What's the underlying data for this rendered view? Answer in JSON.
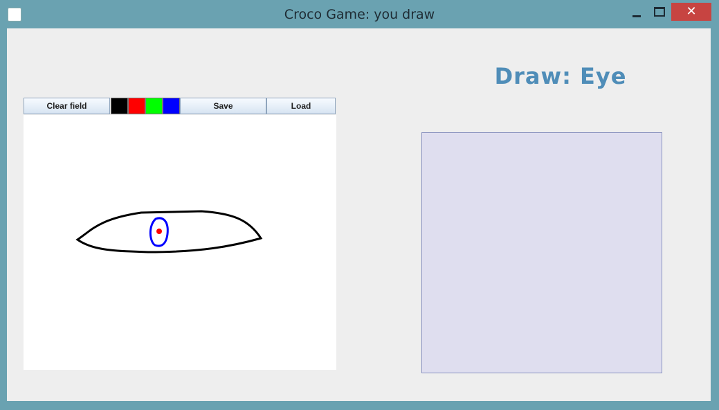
{
  "window": {
    "title": "Croco Game: you draw",
    "close_glyph": "✕"
  },
  "toolbar": {
    "clear_label": "Clear field",
    "save_label": "Save",
    "load_label": "Load",
    "colors": [
      "#000000",
      "#ff0000",
      "#00ff00",
      "#0000ff"
    ]
  },
  "prompt": {
    "text": "Draw: Eye"
  },
  "drawing": {
    "stroke_colors": [
      "#000000",
      "#0000ff",
      "#ff0000"
    ]
  }
}
